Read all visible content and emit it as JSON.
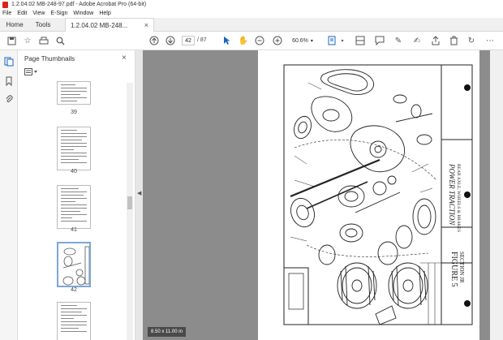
{
  "window": {
    "title": "1.2.04.02  MB-248-97.pdf - Adobe Acrobat Pro (64-bit)"
  },
  "menu": [
    "File",
    "Edit",
    "View",
    "E-Sign",
    "Window",
    "Help"
  ],
  "tabs": {
    "home": "Home",
    "tools": "Tools",
    "doc": "1.2.04.02  MB-248...",
    "close": "×"
  },
  "toolbar": {
    "page_current": "42",
    "page_total": "/ 87",
    "zoom": "60.6%"
  },
  "thumbnails": {
    "title": "Page Thumbnails",
    "close": "×",
    "pages": [
      "39",
      "40",
      "41",
      "42"
    ]
  },
  "document": {
    "page_size": "8.50 x 11.00 in"
  },
  "drawing_text": {
    "figure": "FIGURE 5",
    "section": "SECTION JR",
    "caption": "POWER TRACTION",
    "subcaption": "REAR AXLE, WHEELS & BRAKES"
  }
}
